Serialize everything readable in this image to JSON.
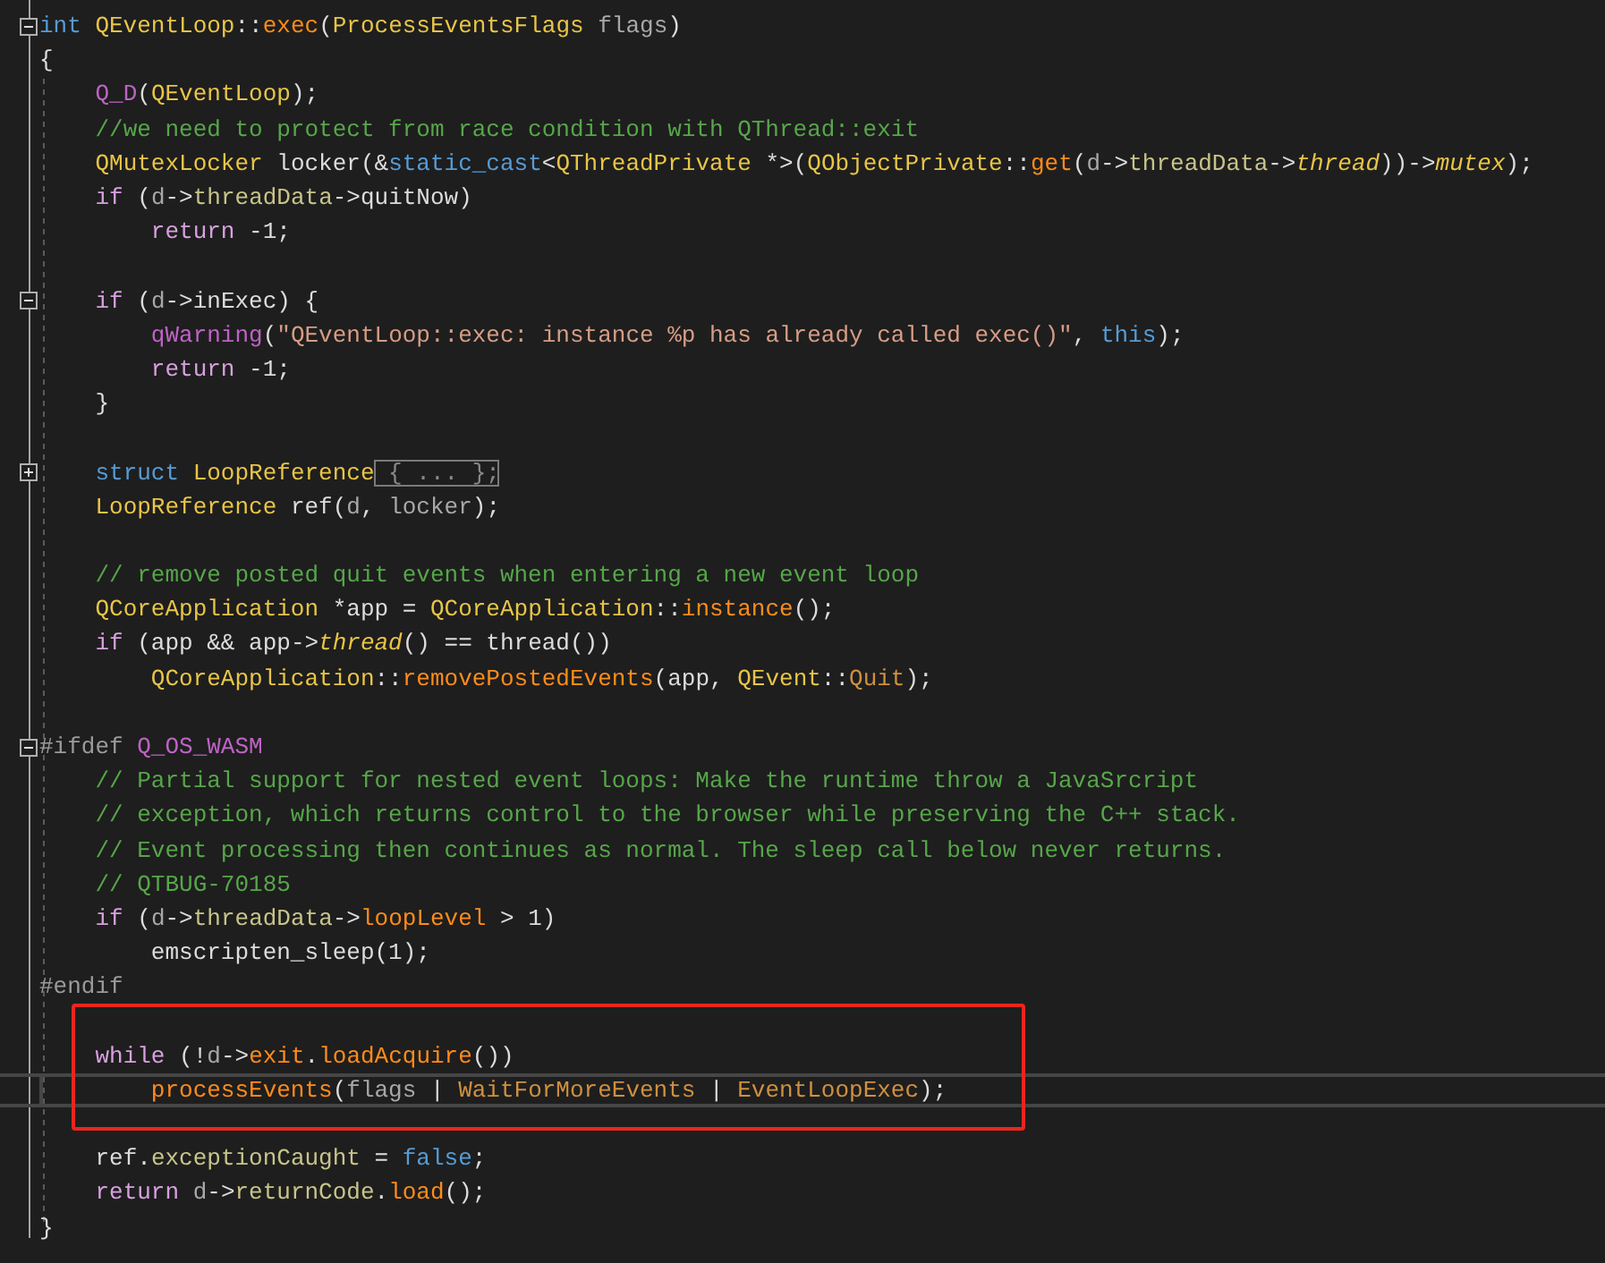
{
  "editor": {
    "blocks": [
      {
        "lines": [
          {
            "collapsed": false,
            "tokens": [
              {
                "text": "int",
                "kind": "kw"
              },
              {
                "text": " QEventLoop",
                "kind": "type"
              },
              {
                "text": "::",
                "kind": "pl"
              },
              {
                "text": "exec",
                "kind": "fn"
              },
              {
                "text": "(",
                "kind": "pl"
              },
              {
                "text": "ProcessEventsFlags",
                "kind": "type"
              },
              {
                "text": " flags",
                "kind": "par"
              },
              {
                "text": ")",
                "kind": "pl"
              }
            ]
          },
          {
            "tokens": [
              {
                "text": "{",
                "kind": "pl"
              }
            ]
          },
          {
            "tokens": [
              {
                "text": "    Q_D",
                "kind": "mac"
              },
              {
                "text": "(",
                "kind": "pl"
              },
              {
                "text": "QEventLoop",
                "kind": "type"
              },
              {
                "text": ");",
                "kind": "pl"
              }
            ]
          },
          {
            "tokens": [
              {
                "text": "    //we need to protect from race condition with QThread::exit",
                "kind": "cm"
              }
            ]
          },
          {
            "tokens": [
              {
                "text": "    QMutexLocker",
                "kind": "type"
              },
              {
                "text": " locker(&",
                "kind": "pl"
              },
              {
                "text": "static_cast",
                "kind": "kw"
              },
              {
                "text": "<",
                "kind": "pl"
              },
              {
                "text": "QThreadPrivate",
                "kind": "type"
              },
              {
                "text": " *>(",
                "kind": "pl"
              },
              {
                "text": "QObjectPrivate",
                "kind": "type"
              },
              {
                "text": "::",
                "kind": "pl"
              },
              {
                "text": "get",
                "kind": "fn"
              },
              {
                "text": "(",
                "kind": "pl"
              },
              {
                "text": "d",
                "kind": "par"
              },
              {
                "text": "->",
                "kind": "pl"
              },
              {
                "text": "threadData",
                "kind": "mem"
              },
              {
                "text": "->",
                "kind": "pl"
              },
              {
                "text": "thread",
                "kind": "ital"
              },
              {
                "text": "))->",
                "kind": "pl"
              },
              {
                "text": "mutex",
                "kind": "ital"
              },
              {
                "text": ");",
                "kind": "pl"
              }
            ]
          },
          {
            "tokens": [
              {
                "text": "    if",
                "kind": "ctl"
              },
              {
                "text": " (",
                "kind": "pl"
              },
              {
                "text": "d",
                "kind": "par"
              },
              {
                "text": "->",
                "kind": "pl"
              },
              {
                "text": "threadData",
                "kind": "mem"
              },
              {
                "text": "->quitNow)",
                "kind": "pl"
              }
            ]
          },
          {
            "tokens": [
              {
                "text": "        return",
                "kind": "ctl"
              },
              {
                "text": " -1;",
                "kind": "pl"
              }
            ]
          }
        ]
      },
      {
        "lines": [
          {
            "collapsed": false,
            "tokens": [
              {
                "text": "    if",
                "kind": "ctl"
              },
              {
                "text": " (",
                "kind": "pl"
              },
              {
                "text": "d",
                "kind": "par"
              },
              {
                "text": "->inExec) {",
                "kind": "pl"
              }
            ]
          },
          {
            "tokens": [
              {
                "text": "        qWarning",
                "kind": "mac"
              },
              {
                "text": "(",
                "kind": "pl"
              },
              {
                "text": "\"QEventLoop::exec: instance %p has already called exec()\"",
                "kind": "str"
              },
              {
                "text": ", ",
                "kind": "pl"
              },
              {
                "text": "this",
                "kind": "kw"
              },
              {
                "text": ");",
                "kind": "pl"
              }
            ]
          },
          {
            "tokens": [
              {
                "text": "        return",
                "kind": "ctl"
              },
              {
                "text": " -1;",
                "kind": "pl"
              }
            ]
          },
          {
            "tokens": [
              {
                "text": "    }",
                "kind": "pl"
              }
            ]
          }
        ]
      },
      {
        "lines": [
          {
            "collapsed": true,
            "tokens": [
              {
                "text": "    struct",
                "kind": "kw"
              },
              {
                "text": " LoopReference",
                "kind": "type"
              },
              {
                "text": " { ... };",
                "kind": "collapsed"
              }
            ]
          },
          {
            "tokens": [
              {
                "text": "    LoopReference",
                "kind": "type"
              },
              {
                "text": " ref(",
                "kind": "pl"
              },
              {
                "text": "d",
                "kind": "par"
              },
              {
                "text": ", ",
                "kind": "pl"
              },
              {
                "text": "locker",
                "kind": "par"
              },
              {
                "text": ");",
                "kind": "pl"
              }
            ]
          }
        ]
      },
      {
        "lines": [
          {
            "tokens": [
              {
                "text": "    // remove posted quit events when entering a new event loop",
                "kind": "cm"
              }
            ]
          },
          {
            "tokens": [
              {
                "text": "    QCoreApplication",
                "kind": "type"
              },
              {
                "text": " *app = ",
                "kind": "pl"
              },
              {
                "text": "QCoreApplication",
                "kind": "type"
              },
              {
                "text": "::",
                "kind": "pl"
              },
              {
                "text": "instance",
                "kind": "fn"
              },
              {
                "text": "();",
                "kind": "pl"
              }
            ]
          },
          {
            "tokens": [
              {
                "text": "    if",
                "kind": "ctl"
              },
              {
                "text": " (app && app->",
                "kind": "pl"
              },
              {
                "text": "thread",
                "kind": "ital"
              },
              {
                "text": "() == thread())",
                "kind": "pl"
              }
            ]
          },
          {
            "tokens": [
              {
                "text": "        QCoreApplication",
                "kind": "type"
              },
              {
                "text": "::",
                "kind": "pl"
              },
              {
                "text": "removePostedEvents",
                "kind": "fn"
              },
              {
                "text": "(app, ",
                "kind": "pl"
              },
              {
                "text": "QEvent",
                "kind": "type"
              },
              {
                "text": "::",
                "kind": "pl"
              },
              {
                "text": "Quit",
                "kind": "en"
              },
              {
                "text": ");",
                "kind": "pl"
              }
            ]
          }
        ]
      },
      {
        "lines": [
          {
            "collapsed": false,
            "tokens": [
              {
                "text": "#ifdef",
                "kind": "pp"
              },
              {
                "text": " Q_OS_WASM",
                "kind": "mac"
              }
            ]
          },
          {
            "tokens": [
              {
                "text": "    // Partial support for nested event loops: Make the runtime throw a JavaSrcript",
                "kind": "cm"
              }
            ]
          },
          {
            "tokens": [
              {
                "text": "    // exception, which returns control to the browser while preserving the C++ stack.",
                "kind": "cm"
              }
            ]
          },
          {
            "tokens": [
              {
                "text": "    // Event processing then continues as normal. The sleep call below never returns.",
                "kind": "cm"
              }
            ]
          },
          {
            "tokens": [
              {
                "text": "    // QTBUG-70185",
                "kind": "cm"
              }
            ]
          },
          {
            "tokens": [
              {
                "text": "    if",
                "kind": "ctl"
              },
              {
                "text": " (",
                "kind": "pl"
              },
              {
                "text": "d",
                "kind": "par"
              },
              {
                "text": "->",
                "kind": "pl"
              },
              {
                "text": "threadData",
                "kind": "mem"
              },
              {
                "text": "->",
                "kind": "pl"
              },
              {
                "text": "loopLevel",
                "kind": "fn"
              },
              {
                "text": " > 1)",
                "kind": "pl"
              }
            ]
          },
          {
            "tokens": [
              {
                "text": "        emscripten_sleep(1);",
                "kind": "pl"
              }
            ]
          },
          {
            "tokens": [
              {
                "text": "#endif",
                "kind": "pp"
              }
            ]
          }
        ]
      },
      {
        "boxed": true,
        "lines": [
          {
            "tokens": [
              {
                "text": "    while",
                "kind": "ctl"
              },
              {
                "text": " (!",
                "kind": "pl"
              },
              {
                "text": "d",
                "kind": "par"
              },
              {
                "text": "->",
                "kind": "pl"
              },
              {
                "text": "exit",
                "kind": "fn"
              },
              {
                "text": ".",
                "kind": "pl"
              },
              {
                "text": "loadAcquire",
                "kind": "fn"
              },
              {
                "text": "())",
                "kind": "pl"
              }
            ]
          },
          {
            "current": true,
            "tokens": [
              {
                "text": "        processEvents",
                "kind": "fn"
              },
              {
                "text": "(",
                "kind": "pl"
              },
              {
                "text": "flags",
                "kind": "par"
              },
              {
                "text": " | ",
                "kind": "pl"
              },
              {
                "text": "WaitForMoreEvents",
                "kind": "en"
              },
              {
                "text": " | ",
                "kind": "pl"
              },
              {
                "text": "EventLoopExec",
                "kind": "en"
              },
              {
                "text": ");",
                "kind": "pl"
              }
            ]
          }
        ]
      },
      {
        "lines": [
          {
            "tokens": [
              {
                "text": "    ref.",
                "kind": "pl"
              },
              {
                "text": "exceptionCaught",
                "kind": "mem"
              },
              {
                "text": " = ",
                "kind": "pl"
              },
              {
                "text": "false",
                "kind": "kw"
              },
              {
                "text": ";",
                "kind": "pl"
              }
            ]
          },
          {
            "tokens": [
              {
                "text": "    return",
                "kind": "ctl"
              },
              {
                "text": " d",
                "kind": "par"
              },
              {
                "text": "->",
                "kind": "pl"
              },
              {
                "text": "returnCode",
                "kind": "mem"
              },
              {
                "text": ".",
                "kind": "pl"
              },
              {
                "text": "load",
                "kind": "fn"
              },
              {
                "text": "();",
                "kind": "pl"
              }
            ]
          },
          {
            "tokens": [
              {
                "text": "}",
                "kind": "pl"
              }
            ]
          }
        ]
      }
    ]
  }
}
